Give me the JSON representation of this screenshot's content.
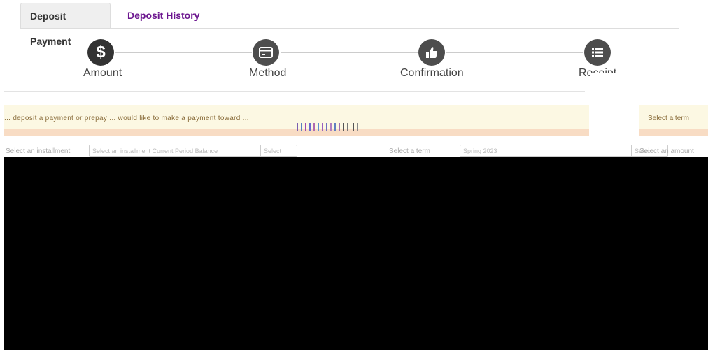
{
  "tabs": {
    "active_label": "Deposit Payment",
    "link_label": "Deposit History"
  },
  "steps": [
    {
      "label": "Amount",
      "icon": "dollar-icon",
      "active": true
    },
    {
      "label": "Method",
      "icon": "credit-card-icon",
      "active": false
    },
    {
      "label": "Confirmation",
      "icon": "thumbs-up-icon",
      "active": false
    },
    {
      "label": "Receipt",
      "icon": "list-icon",
      "active": false
    }
  ],
  "notice": {
    "text": "... deposit a payment or prepay ... would like to make a payment toward ...",
    "side_text": "Select a term"
  },
  "form": {
    "left_label": "Select an installment",
    "left_input": "Select an installment Current Period Balance",
    "left_addon": "Select",
    "right_label": "Select a term",
    "right_input": "Spring 2023",
    "right_addon": "Select",
    "far_right_label": "Select an amount"
  },
  "colors": {
    "accent_purple": "#6c168f",
    "step_dark": "#333333",
    "notice_bg": "#fcf8e3",
    "notice_border": "#f8dcc4"
  }
}
